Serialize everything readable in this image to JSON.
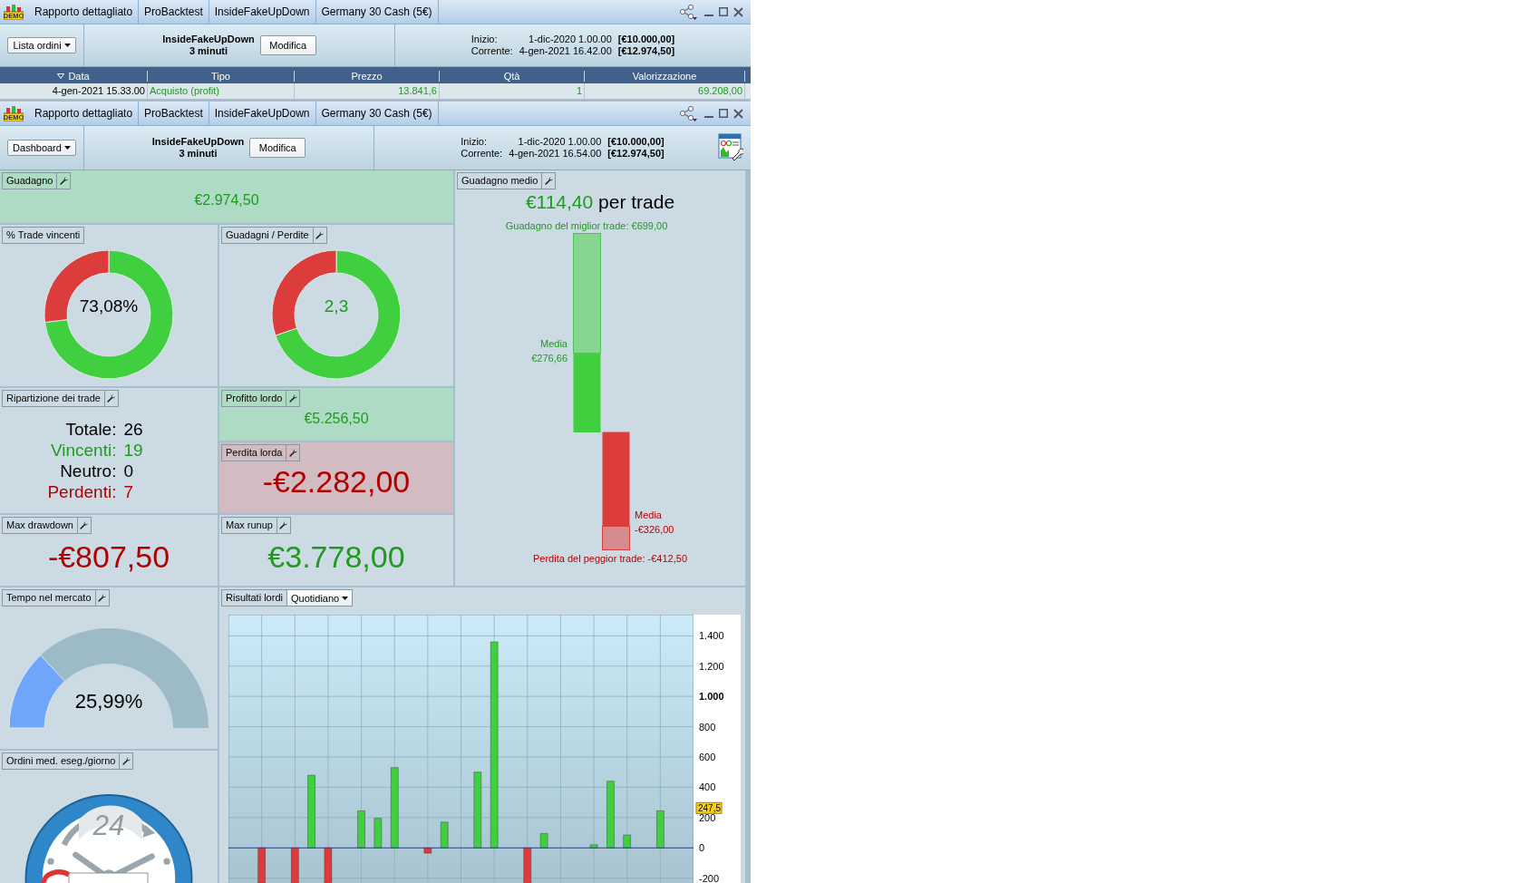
{
  "order_window": {
    "logo_text": "DEMO",
    "tabs": [
      "Rapporto dettagliato",
      "ProBacktest",
      "InsideFakeUpDown",
      "Germany 30 Cash (5€)"
    ],
    "view_dropdown": "Lista ordini",
    "system_name": "InsideFakeUpDown",
    "timeframe": "3 minuti",
    "edit_button": "Modifica",
    "info": [
      {
        "label": "Inizio:",
        "date": "1-dic-2020 1.00.00",
        "amount": "[€10.000,00]"
      },
      {
        "label": "Corrente:",
        "date": "4-gen-2021 16.42.00",
        "amount": "[€12.974,50]"
      }
    ],
    "table": {
      "columns": [
        {
          "label": "Data",
          "sorted": true
        },
        {
          "label": "Tipo",
          "sorted": false
        },
        {
          "label": "Prezzo",
          "sorted": false
        },
        {
          "label": "Qtà",
          "sorted": false
        },
        {
          "label": "Valorizzazione",
          "sorted": false
        }
      ],
      "rows": [
        {
          "cells": [
            "4-gen-2021 15.33.00",
            "Acquisto (profit)",
            "13.841,6",
            "1",
            "69.208,00"
          ]
        }
      ]
    }
  },
  "dashboard_window": {
    "logo_text": "DEMO",
    "tabs": [
      "Rapporto dettagliato",
      "ProBacktest",
      "InsideFakeUpDown",
      "Germany 30 Cash (5€)"
    ],
    "view_dropdown": "Dashboard",
    "system_name": "InsideFakeUpDown",
    "timeframe": "3 minuti",
    "edit_button": "Modifica",
    "info": [
      {
        "label": "Inizio:",
        "date": "1-dic-2020 1.00.00",
        "amount": "[€10.000,00]"
      },
      {
        "label": "Corrente:",
        "date": "4-gen-2021 16.54.00",
        "amount": "[€12.974,50]"
      }
    ],
    "dashboard": {
      "profit": {
        "label": "Guadagno",
        "settings_button": true,
        "value": "€2.974,50",
        "color": "#1f9a1f"
      },
      "win_rate": {
        "label": "% Trade vincenti",
        "settings_button": false,
        "value": "73,08%",
        "color": "#000000",
        "chart_data": {
          "type": "donut",
          "values": [
            73.08,
            26.92
          ]
        }
      },
      "gain_loss_ratio": {
        "label": "Guadagni / Perdite",
        "settings_button": true,
        "value": "2,3",
        "color": "#1f9a1f",
        "chart_data": {
          "type": "donut",
          "values": [
            69.73,
            30.27
          ]
        }
      },
      "average_gain": {
        "label": "Guadagno medio",
        "settings_button": true,
        "value": "€114,40",
        "suffix": "per trade",
        "best": "Guadagno del miglior trade: €699,00",
        "average_win_label": "Media",
        "average_win": "€276,66",
        "average_loss_label": "Media",
        "average_loss": "-€326,00",
        "worst": "Perdita del peggior trade: -€412,50"
      },
      "trade_breakdown": {
        "label": "Ripartizione dei trade",
        "settings_button": true,
        "lines": [
          {
            "label": "Totale:",
            "value": "26",
            "color": "#000000"
          },
          {
            "label": "Vincenti:",
            "value": "19",
            "color": "#1f9a1f"
          },
          {
            "label": "Neutro:",
            "value": "0",
            "color": "#000000"
          },
          {
            "label": "Perdenti:",
            "value": "7",
            "color": "#b00000"
          }
        ]
      },
      "gross_profit": {
        "label": "Profitto lordo",
        "settings_button": true,
        "value": "€5.256,50",
        "color": "#1f9a1f"
      },
      "gross_loss": {
        "label": "Perdita lorda",
        "settings_button": true,
        "value": "-€2.282,00",
        "color": "#b00000"
      },
      "max_drawdown": {
        "label": "Max drawdown",
        "settings_button": true,
        "value": "-€807,50",
        "color": "#b00000"
      },
      "max_runup": {
        "label": "Max runup",
        "settings_button": true,
        "value": "€3.778,00",
        "color": "#1f9a1f"
      },
      "time_in_market": {
        "label": "Tempo nel mercato",
        "settings_button": true,
        "value": "25,99%",
        "level": 0.2599
      },
      "daily_orders": {
        "label": "Ordini med. eseg./giorno",
        "settings_button": true,
        "dial_text": "24"
      },
      "gross_results": {
        "label": "Risultati lordi",
        "period_dropdown": "Quotidiano",
        "chart_data": {
          "type": "bar",
          "ylim": [
            -262,
            1540
          ],
          "grid": true,
          "yticks": [
            {
              "value": -200,
              "label": "-200"
            },
            {
              "value": 0,
              "label": "0"
            },
            {
              "value": 200,
              "label": "200"
            },
            {
              "value": 400,
              "label": "400"
            },
            {
              "value": 600,
              "label": "600"
            },
            {
              "value": 800,
              "label": "800"
            },
            {
              "value": 1000,
              "label": "1.000"
            },
            {
              "value": 1200,
              "label": "1.200"
            },
            {
              "value": 1400,
              "label": "1.400"
            }
          ],
          "series": [
            {
              "color": "#3fcf3f",
              "values": [
                null,
                null,
                null,
                null,
                null,
                480,
                null,
                null,
                245,
                195,
                530,
                null,
                null,
                170,
                null,
                500,
                1360,
                null,
                null,
                95,
                null,
                null,
                20,
                440,
                85,
                null,
                245,
                null
              ]
            },
            {
              "color": "#dd3b3b",
              "values": [
                null,
                null,
                -250,
                null,
                -250,
                null,
                -250,
                null,
                null,
                null,
                null,
                null,
                -35,
                null,
                null,
                null,
                null,
                null,
                -250,
                null,
                null,
                null,
                null,
                null,
                null,
                null,
                null,
                null
              ]
            }
          ],
          "ref_lines": [
            {
              "axis": "y",
              "value": 0,
              "color": "#2231e0"
            }
          ],
          "annotations": [
            "247,5"
          ]
        }
      }
    }
  }
}
